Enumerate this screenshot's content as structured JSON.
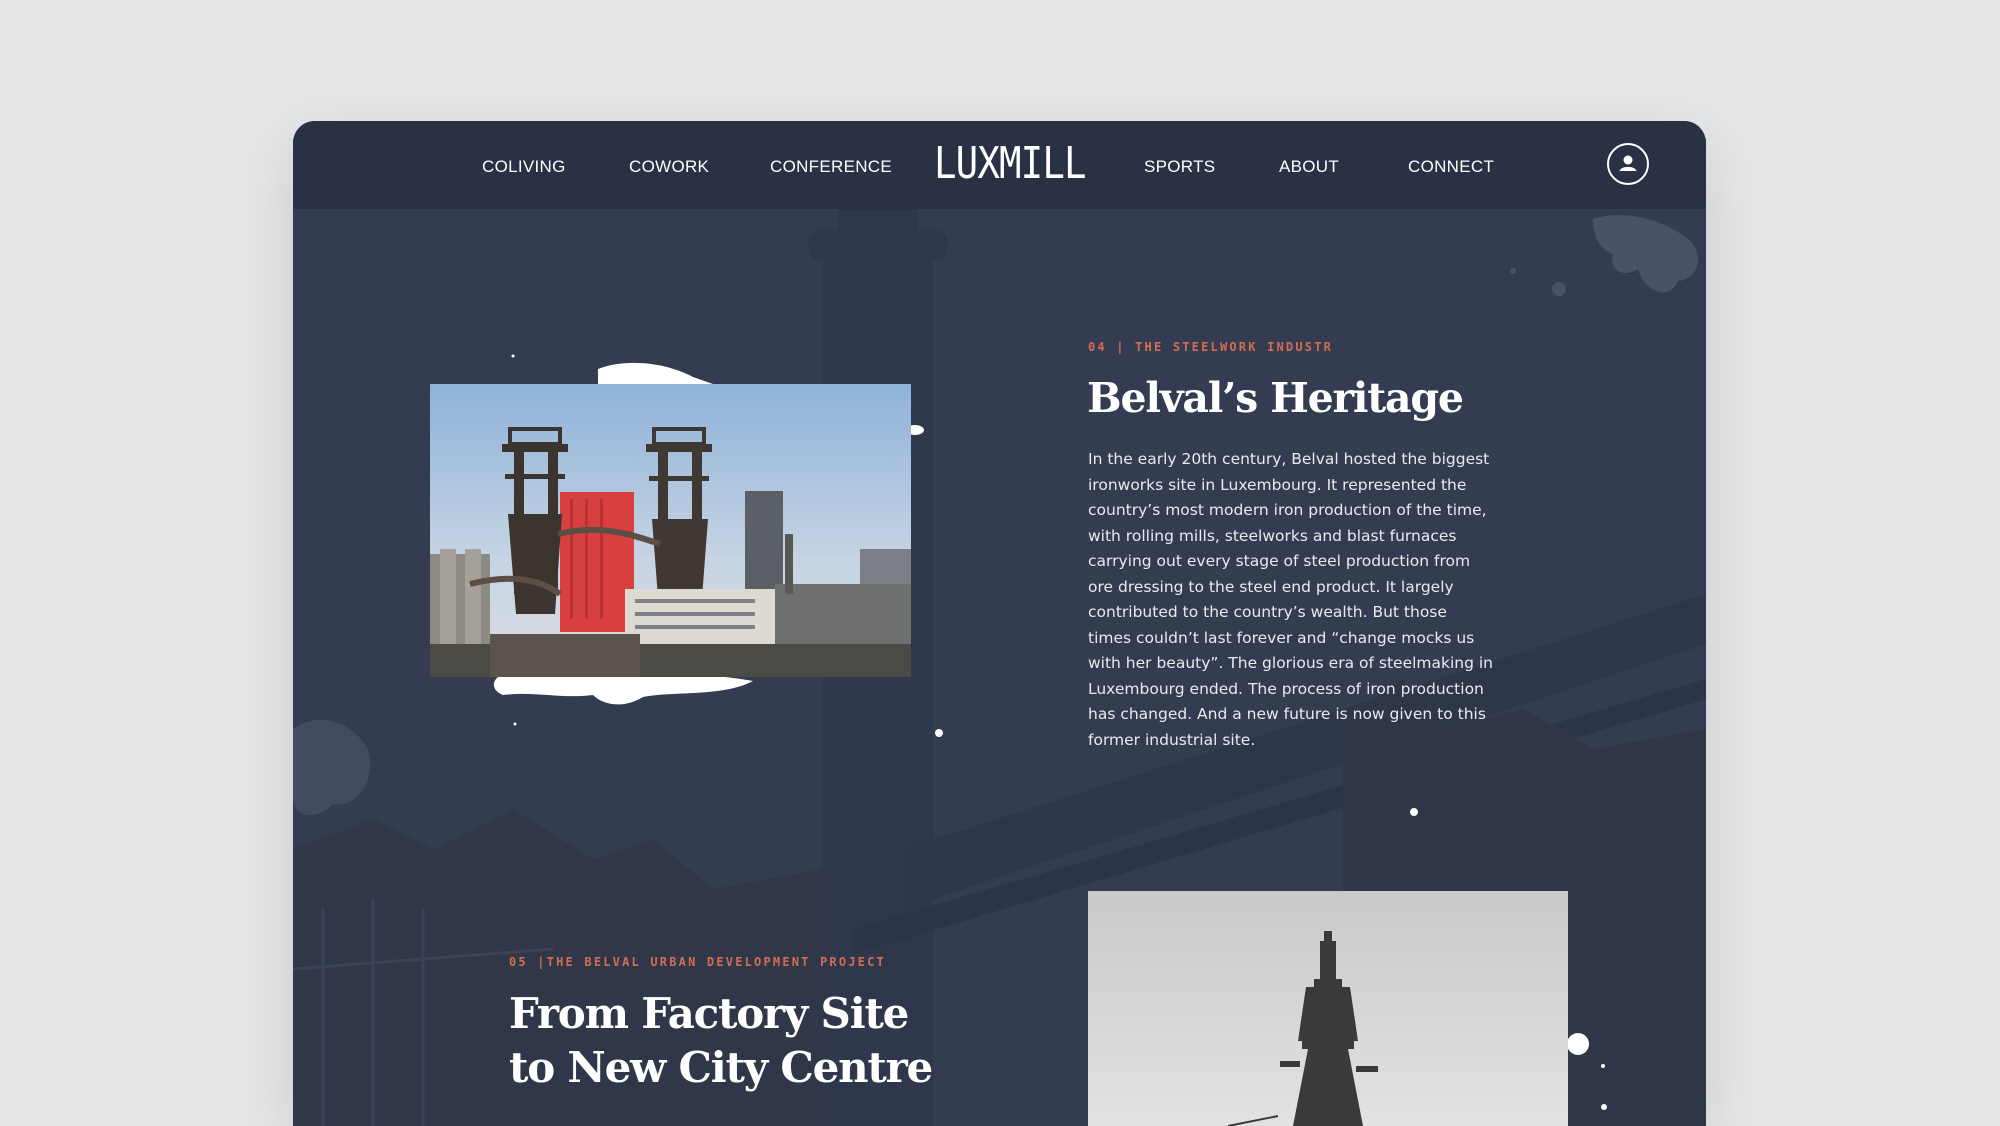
{
  "nav": {
    "items_left": [
      "COLIVING",
      "COWORK",
      "CONFERENCE"
    ],
    "logo": "LUXMILL",
    "items_right": [
      "SPORTS",
      "ABOUT",
      "CONNECT"
    ],
    "user_icon": "user-circle-icon"
  },
  "section_04": {
    "eyebrow": "04 | THE STEELWORK INDUSTR",
    "title": "Belval’s Heritage",
    "body": "In the early 20th century, Belval hosted the biggest ironworks site in Luxembourg. It represented the country’s most modern iron production of the time, with rolling mills, steelworks and blast furnaces carrying out every stage of steel production from ore dressing to the steel end product. It largely contributed to the country’s wealth. But those times couldn’t last forever and “change mocks us with her beauty”. The glorious era of steelmaking in Luxembourg ended. The process of iron production has changed. And a new future is now given to this former industrial site."
  },
  "section_05": {
    "eyebrow": "05 |THE BELVAL URBAN DEVELOPMENT PROJECT",
    "title_line1": "From Factory Site",
    "title_line2": "to New City Centre"
  },
  "colors": {
    "accent": "#d36d52",
    "nav_bg": "#2a3145",
    "content_bg": "#343c52",
    "page_bg": "#e5e6e8"
  }
}
